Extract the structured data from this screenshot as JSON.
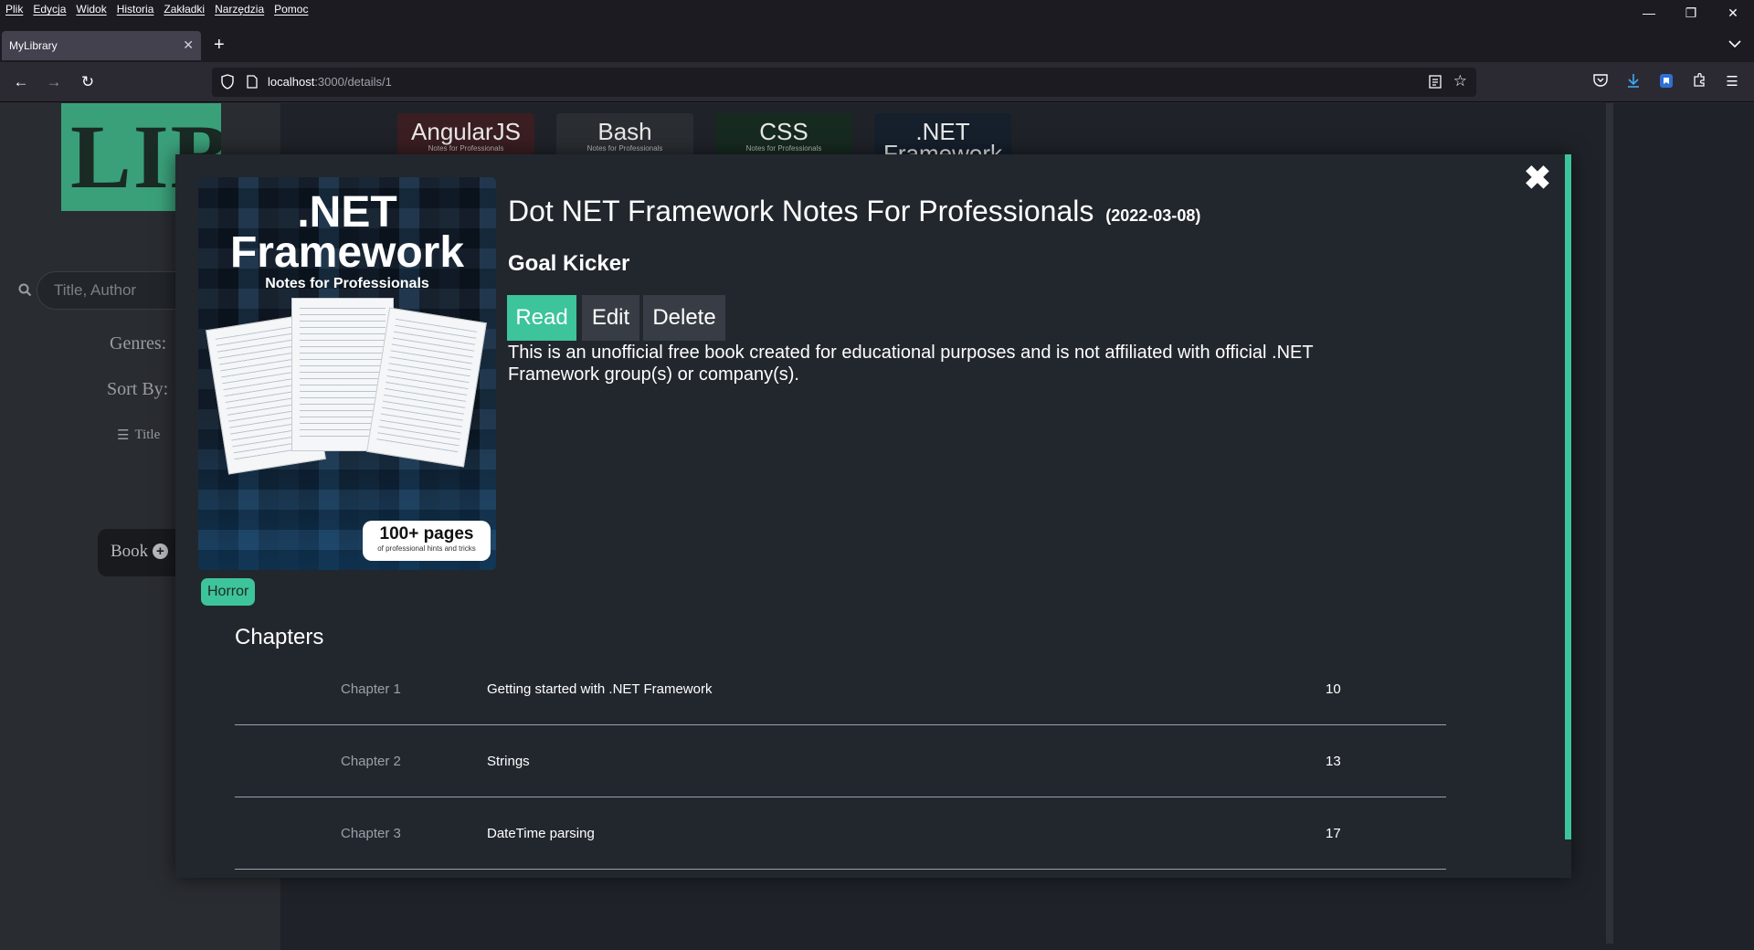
{
  "browser": {
    "menu": [
      "Plik",
      "Edycja",
      "Widok",
      "Historia",
      "Zakładki",
      "Narzędzia",
      "Pomoc"
    ],
    "tab_title": "MyLibrary",
    "url_host": "localhost",
    "url_rest": ":3000/details/1"
  },
  "sidebar": {
    "logo_text": "LIB",
    "search_placeholder": "Title, Author",
    "genres_label": "Genres:",
    "sort_label": "Sort By:",
    "sort_option": "Title",
    "add_book_label": "Book"
  },
  "carousel": [
    {
      "title": "AngularJS",
      "subtitle": "Notes for Professionals"
    },
    {
      "title": "Bash",
      "subtitle": "Notes for Professionals"
    },
    {
      "title": "CSS",
      "subtitle": "Notes for Professionals"
    },
    {
      "title": ".NET",
      "subtitle": "Framework"
    }
  ],
  "modal": {
    "cover": {
      "line1": ".NET",
      "line2": "Framework",
      "line3": "Notes for Professionals",
      "badge_main": "100+ pages",
      "badge_sub": "of professional hints and tricks"
    },
    "title": "Dot NET Framework Notes For Professionals",
    "date": "(2022-03-08)",
    "author": "Goal Kicker",
    "buttons": {
      "read": "Read",
      "edit": "Edit",
      "delete": "Delete"
    },
    "description": "This is an unofficial free book created for educational purposes and is not affiliated with official .NET Framework group(s) or company(s).",
    "genre": "Horror",
    "chapters_heading": "Chapters",
    "chapters": [
      {
        "number": "Chapter 1",
        "title": "Getting started with .NET Framework",
        "page": "10"
      },
      {
        "number": "Chapter 2",
        "title": "Strings",
        "page": "13"
      },
      {
        "number": "Chapter 3",
        "title": "DateTime parsing",
        "page": "17"
      }
    ]
  },
  "colors": {
    "accent": "#3dc49a",
    "modal_bg": "#22272e",
    "page_bg": "#1f2329",
    "button_secondary": "#383d45"
  }
}
